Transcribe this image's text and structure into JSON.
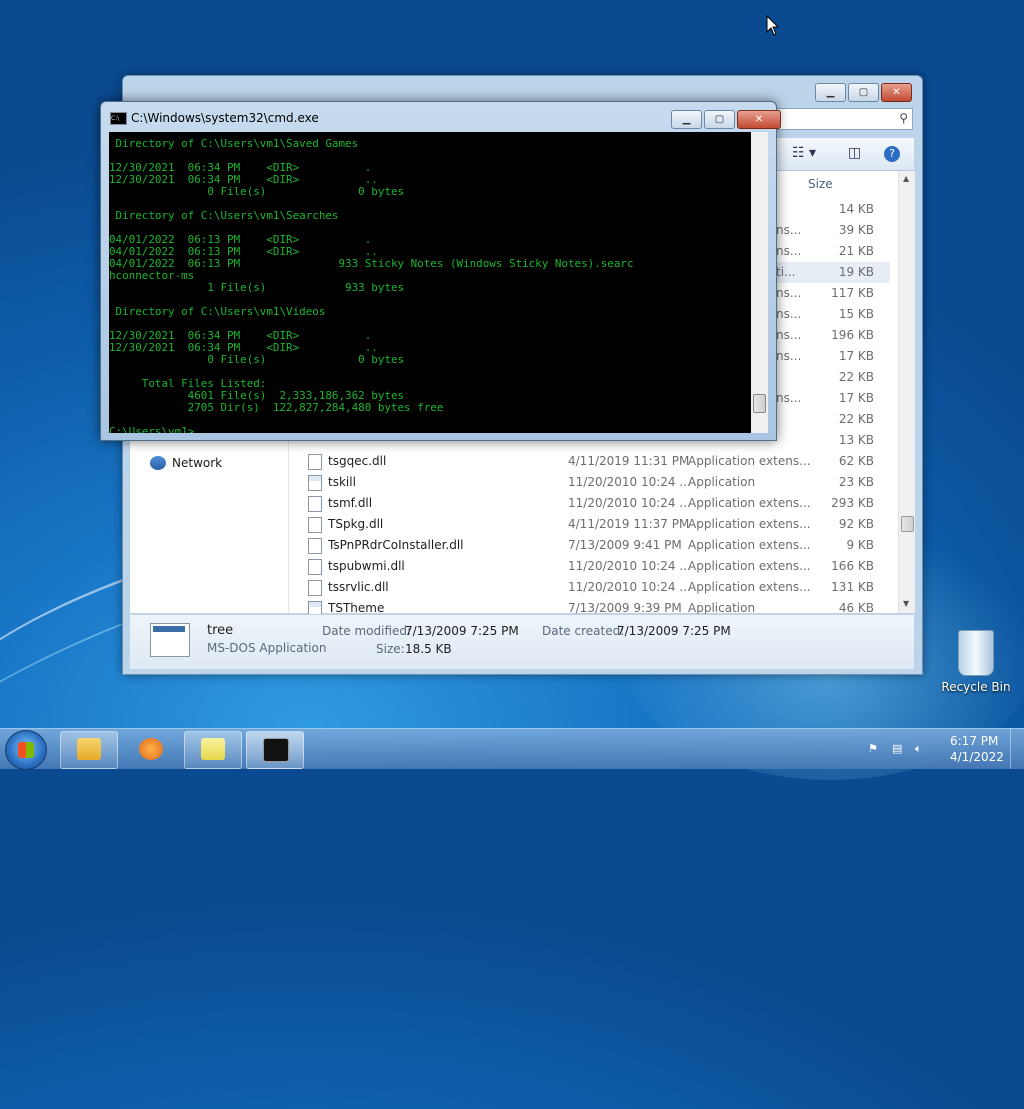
{
  "cmd": {
    "title": "C:\\Windows\\system32\\cmd.exe",
    "output": " Directory of C:\\Users\\vm1\\Saved Games\n\n12/30/2021  06:34 PM    <DIR>          .\n12/30/2021  06:34 PM    <DIR>          ..\n               0 File(s)              0 bytes\n\n Directory of C:\\Users\\vm1\\Searches\n\n04/01/2022  06:13 PM    <DIR>          .\n04/01/2022  06:13 PM    <DIR>          ..\n04/01/2022  06:13 PM               933 Sticky Notes (Windows Sticky Notes).searc\nhconnector-ms\n               1 File(s)            933 bytes\n\n Directory of C:\\Users\\vm1\\Videos\n\n12/30/2021  06:34 PM    <DIR>          .\n12/30/2021  06:34 PM    <DIR>          ..\n               0 File(s)              0 bytes\n\n     Total Files Listed:\n            4601 File(s)  2,333,186,362 bytes\n            2705 Dir(s)  122,827,284,480 bytes free\n\nC:\\Users\\vm1>",
    "buttons": {
      "minimize": "▁",
      "maximize": "▢",
      "close": "✕"
    }
  },
  "explorer": {
    "search_icon": "search-icon",
    "column_size": "Size",
    "nav": {
      "network": "Network"
    },
    "partial_sizes": [
      "14 KB",
      "39 KB",
      "21 KB",
      "19 KB",
      "117 KB",
      "15 KB",
      "196 KB",
      "17 KB",
      "22 KB",
      "17 KB",
      "22 KB",
      "13 KB"
    ],
    "partial_type_frags": [
      "",
      "ns...",
      "ns...",
      "ti...",
      "ns...",
      "ns...",
      "ns...",
      "ns...",
      "",
      "ns...",
      "",
      ""
    ],
    "files": [
      {
        "name": "tsgqec.dll",
        "date": "4/11/2019 11:31 PM",
        "type": "Application extens...",
        "size": "62 KB"
      },
      {
        "name": "tskill",
        "date": "11/20/2010 10:24 ...",
        "type": "Application",
        "size": "23 KB"
      },
      {
        "name": "tsmf.dll",
        "date": "11/20/2010 10:24 ...",
        "type": "Application extens...",
        "size": "293 KB"
      },
      {
        "name": "TSpkg.dll",
        "date": "4/11/2019 11:37 PM",
        "type": "Application extens...",
        "size": "92 KB"
      },
      {
        "name": "TsPnPRdrCoInstaller.dll",
        "date": "7/13/2009 9:41 PM",
        "type": "Application extens...",
        "size": "9 KB"
      },
      {
        "name": "tspubwmi.dll",
        "date": "11/20/2010 10:24 ...",
        "type": "Application extens...",
        "size": "166 KB"
      },
      {
        "name": "tssrvlic.dll",
        "date": "11/20/2010 10:24 ...",
        "type": "Application extens...",
        "size": "131 KB"
      },
      {
        "name": "TSTheme",
        "date": "7/13/2009 9:39 PM",
        "type": "Application",
        "size": "46 KB"
      }
    ],
    "details": {
      "name": "tree",
      "kind": "MS-DOS Application",
      "modified_label": "Date modified:",
      "modified_value": "7/13/2009 7:25 PM",
      "created_label": "Date created:",
      "created_value": "7/13/2009 7:25 PM",
      "size_label": "Size:",
      "size_value": "18.5 KB"
    }
  },
  "desktop": {
    "recycle_bin": "Recycle Bin"
  },
  "taskbar": {
    "time": "6:17 PM",
    "date": "4/1/2022",
    "pinned": [
      "file-explorer-icon",
      "media-player-icon",
      "sticky-notes-icon",
      "cmd-icon"
    ]
  }
}
